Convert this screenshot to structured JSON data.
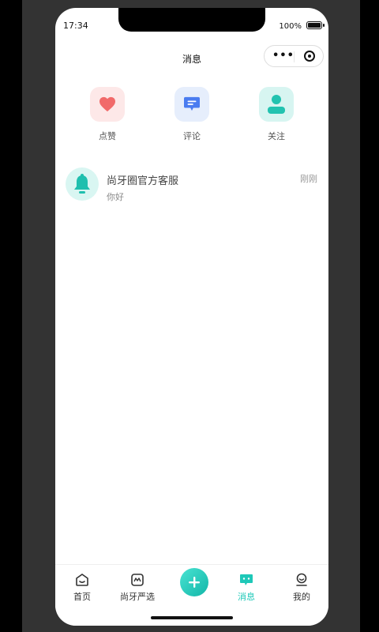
{
  "status_bar": {
    "time": "17:34",
    "battery": "100%"
  },
  "nav": {
    "title": "消息",
    "capsule_dots": "•••"
  },
  "quick_actions": [
    {
      "label": "点赞",
      "icon": "heart-icon",
      "color": "#f16a6a",
      "bg": "#fde8e8"
    },
    {
      "label": "评论",
      "icon": "comment-icon",
      "color": "#4a7cf0",
      "bg": "#e6eefc"
    },
    {
      "label": "关注",
      "icon": "user-icon",
      "color": "#22c3b0",
      "bg": "#d7f5f1"
    }
  ],
  "messages": [
    {
      "name": "尚牙圈官方客服",
      "preview": "你好",
      "time": "刚刚",
      "icon": "bell-icon"
    }
  ],
  "tabbar": {
    "items": [
      {
        "label": "首页",
        "icon": "home-icon"
      },
      {
        "label": "尚牙严选",
        "icon": "shop-icon"
      },
      {
        "label": "消息",
        "icon": "message-icon",
        "active": true
      },
      {
        "label": "我的",
        "icon": "profile-icon"
      }
    ],
    "accent": "#1ec8b8"
  }
}
